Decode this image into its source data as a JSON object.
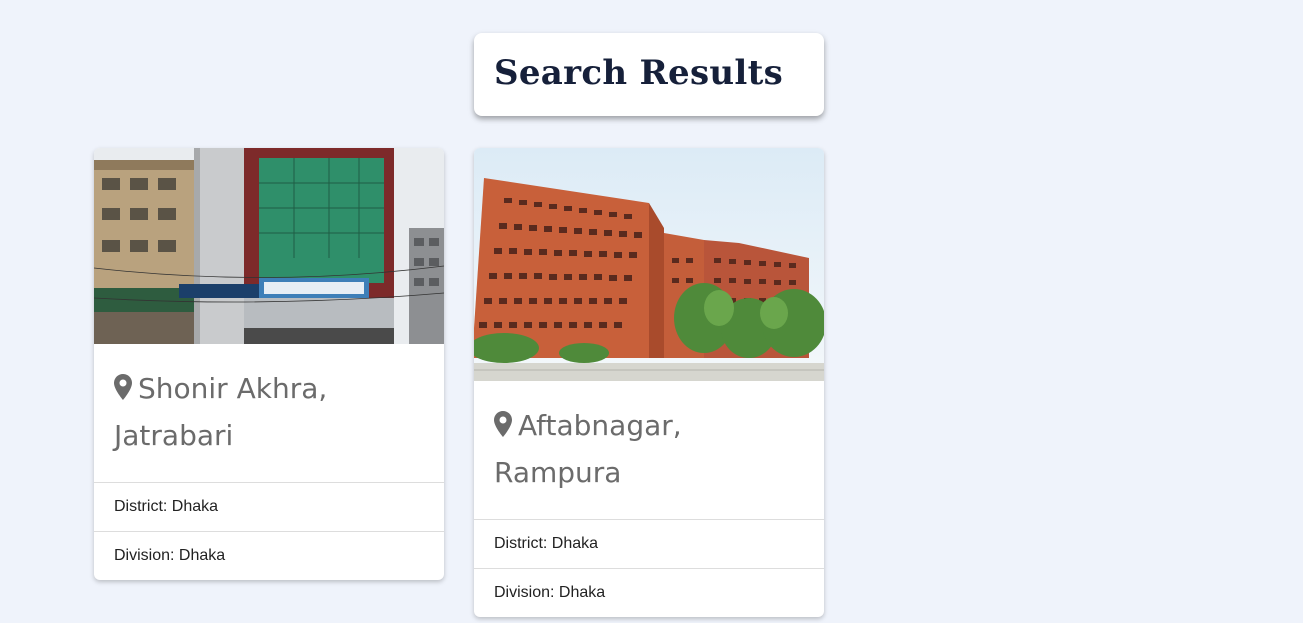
{
  "header": {
    "title": "Search Results"
  },
  "results": [
    {
      "place_line1": "Shonir Akhra,",
      "place_line2": "Jatrabari",
      "district": "District: Dhaka",
      "division": "Division: Dhaka",
      "icon": "map-pin-icon"
    },
    {
      "place_line1": "Aftabnagar,",
      "place_line2": "Rampura",
      "district": "District: Dhaka",
      "division": "Division: Dhaka",
      "icon": "map-pin-icon"
    }
  ],
  "colors": {
    "background": "#eff3fb",
    "title_text": "#16203a",
    "place_text": "#6b6b6b",
    "row_text": "#222222"
  }
}
